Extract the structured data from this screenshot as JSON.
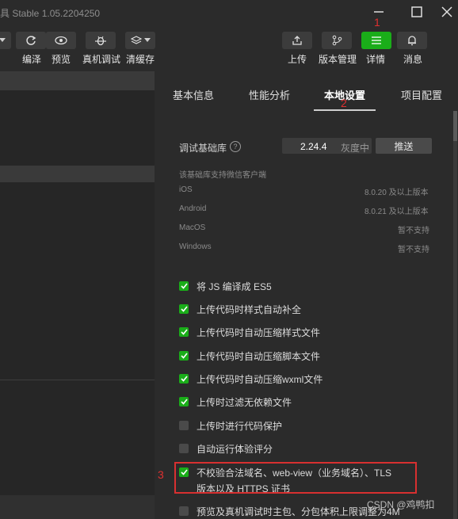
{
  "titlebar": {
    "title": "具 Stable 1.05.2204250"
  },
  "toolbar": {
    "items": [
      {
        "label": "编泽"
      },
      {
        "label": "预览"
      },
      {
        "label": "真机调试"
      },
      {
        "label": "清缓存"
      }
    ],
    "right_items": [
      {
        "label": "上传"
      },
      {
        "label": "版本管理"
      },
      {
        "label": "详情"
      },
      {
        "label": "消息"
      }
    ]
  },
  "tabs": [
    "基本信息",
    "性能分析",
    "本地设置",
    "项目配置"
  ],
  "annotations": {
    "one": "1",
    "two": "2",
    "three": "3"
  },
  "settings": {
    "base_lib_label": "调试基础库",
    "base_lib_version": "2.24.4",
    "base_lib_usage": "灰度中",
    "push_button": "推送",
    "support_title": "该基础库支持微信客户端",
    "platforms": [
      {
        "name": "iOS",
        "value": "8.0.20 及以上版本"
      },
      {
        "name": "Android",
        "value": "8.0.21 及以上版本"
      },
      {
        "name": "MacOS",
        "value": "暂不支持"
      },
      {
        "name": "Windows",
        "value": "暂不支持"
      }
    ],
    "checkboxes": [
      {
        "label": "将 JS 编译成 ES5",
        "checked": true
      },
      {
        "label": "上传代码时样式自动补全",
        "checked": true
      },
      {
        "label": "上传代码时自动压缩样式文件",
        "checked": true
      },
      {
        "label": "上传代码时自动压缩脚本文件",
        "checked": true
      },
      {
        "label": "上传代码时自动压缩wxml文件",
        "checked": true
      },
      {
        "label": "上传时过滤无依赖文件",
        "checked": true
      },
      {
        "label": "上传时进行代码保护",
        "checked": false
      },
      {
        "label": "自动运行体验评分",
        "checked": false
      },
      {
        "label": "不校验合法域名、web-view（业务域名）、TLS",
        "label2": "版本以及 HTTPS 证书",
        "checked": true
      },
      {
        "label": "预览及真机调试时主包、分包体积上限调整为4M",
        "checked": false
      }
    ]
  },
  "watermark": "CSDN @鸡鸭扣",
  "colors": {
    "accent": "#1aad19",
    "annotation": "#d83030"
  }
}
